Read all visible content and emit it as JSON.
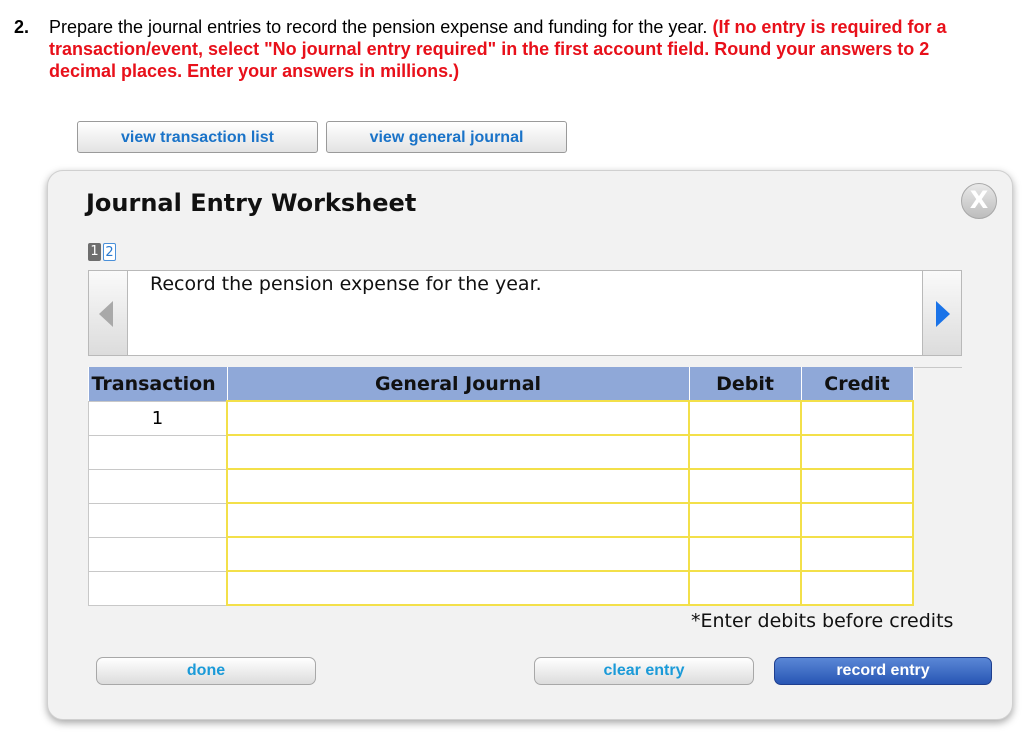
{
  "question": {
    "number": "2.",
    "text": "Prepare the journal entries to record the pension expense and funding for the year.",
    "instruction": "(If no entry is required for a transaction/event, select \"No journal entry required\" in the first account field. Round your answers to 2 decimal places. Enter your answers in millions.)"
  },
  "toolbar": {
    "view_transaction_list": "view transaction list",
    "view_general_journal": "view general journal"
  },
  "worksheet": {
    "title": "Journal Entry Worksheet",
    "close_glyph": "X",
    "pages": [
      "1",
      "2"
    ],
    "active_page": "1",
    "instruction": "Record the pension expense for the year.",
    "table": {
      "headers": [
        "Transaction",
        "General Journal",
        "Debit",
        "Credit"
      ],
      "rows": [
        {
          "transaction": "1",
          "account": "",
          "debit": "",
          "credit": ""
        },
        {
          "transaction": "",
          "account": "",
          "debit": "",
          "credit": ""
        },
        {
          "transaction": "",
          "account": "",
          "debit": "",
          "credit": ""
        },
        {
          "transaction": "",
          "account": "",
          "debit": "",
          "credit": ""
        },
        {
          "transaction": "",
          "account": "",
          "debit": "",
          "credit": ""
        },
        {
          "transaction": "",
          "account": "",
          "debit": "",
          "credit": ""
        }
      ]
    },
    "note": "*Enter debits before credits",
    "buttons": {
      "done": "done",
      "clear_entry": "clear entry",
      "record_entry": "record entry"
    }
  },
  "colors": {
    "question_red": "#e8101a",
    "link_blue": "#1a73c8",
    "header_blue": "#8fa8d8",
    "input_yellow": "#f3e04a",
    "record_button": "#2856b4"
  }
}
